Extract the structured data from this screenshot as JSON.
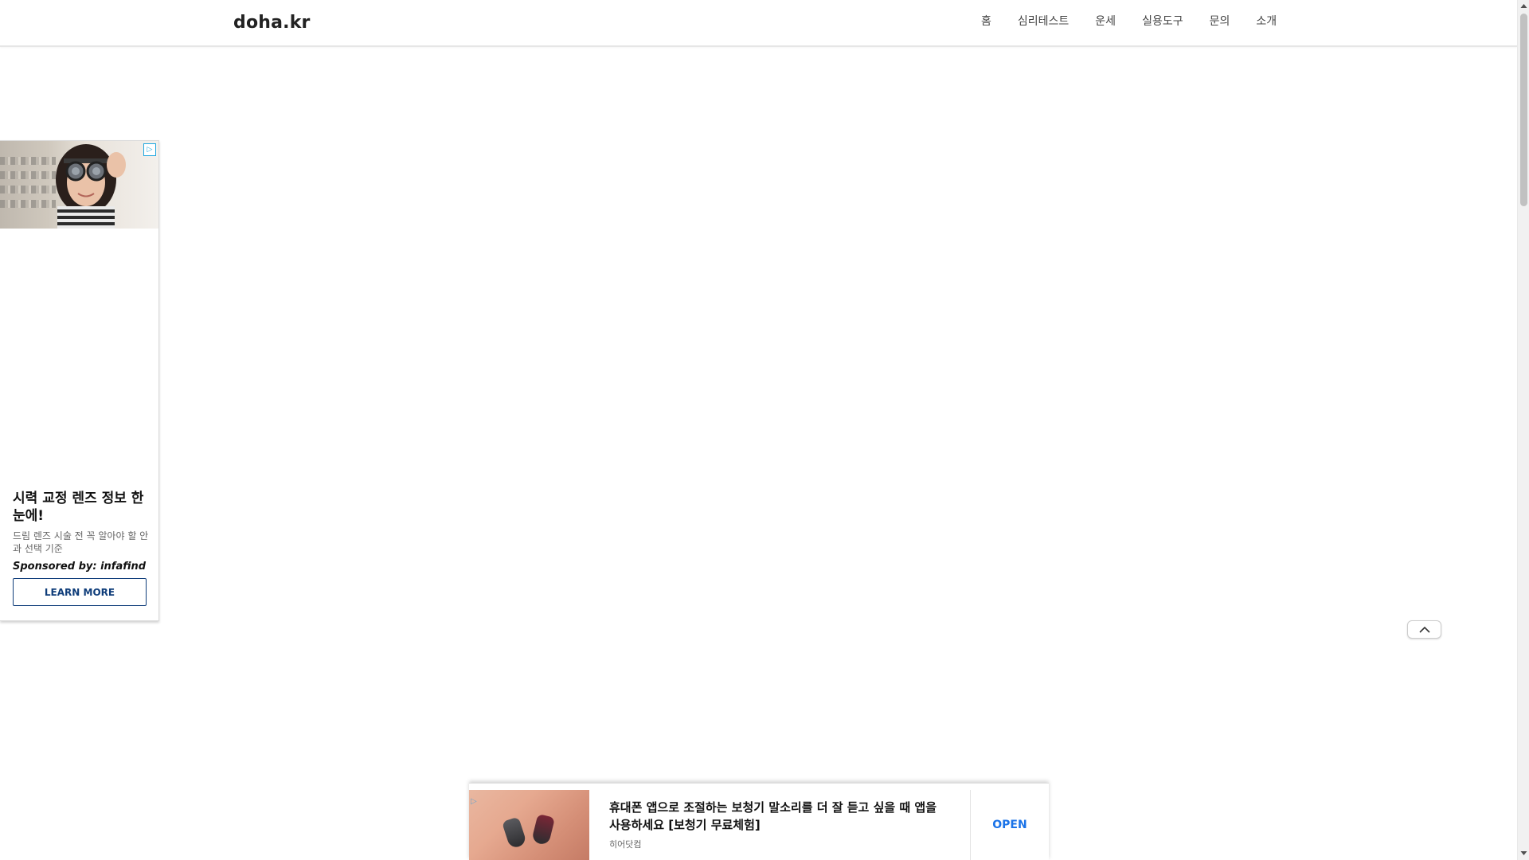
{
  "header": {
    "logo": "doha.kr",
    "nav": [
      "홈",
      "심리테스트",
      "운세",
      "실용도구",
      "문의",
      "소개"
    ]
  },
  "left_ad": {
    "title": "시력 교정 렌즈 정보 한눈에!",
    "description": "드림 렌즈 시술 전 꼭 알아야 할 안과 선택 기준",
    "sponsor": "Sponsored by: infafind",
    "button": "LEARN MORE",
    "choices_icon": "ad-choices-icon"
  },
  "bottom_ad": {
    "text": "휴대폰 앱으로 조절하는 보청기 말소리를 더 잘 듣고 싶을 때 앱을 사용하세요 [보청기 무료체험]",
    "source": "히어닷컴",
    "button": "OPEN"
  },
  "icons": {
    "scroll_to_top": "chevron-up-icon"
  },
  "colors": {
    "accent_blue": "#1a73e8",
    "ad_button_navy": "#0f3d7a"
  }
}
